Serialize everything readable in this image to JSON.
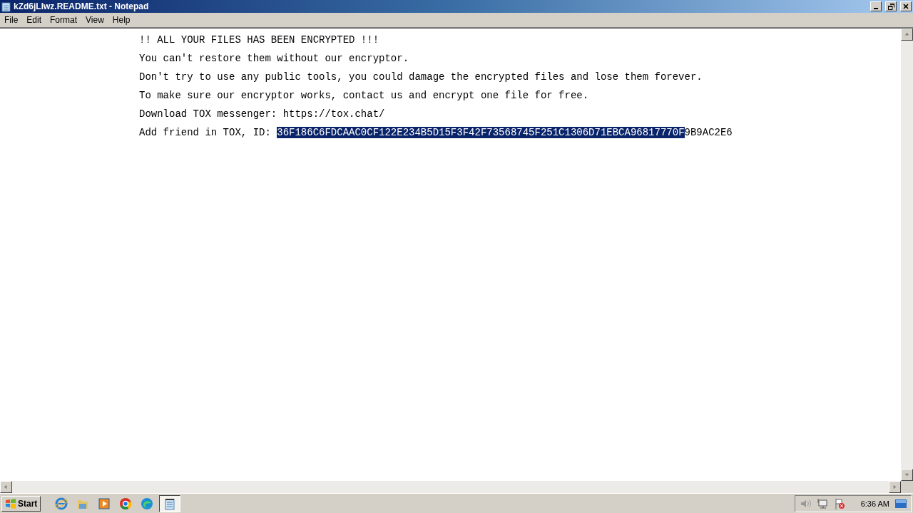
{
  "window": {
    "title": "kZd6jLIwz.README.txt - Notepad"
  },
  "menu": [
    "File",
    "Edit",
    "Format",
    "View",
    "Help"
  ],
  "document": {
    "lines": [
      {
        "segments": [
          {
            "text": "!! ALL YOUR FILES HAS BEEN ENCRYPTED !!!",
            "selected": false
          }
        ]
      },
      {
        "segments": [
          {
            "text": "You can't restore them without our encryptor.",
            "selected": false
          }
        ]
      },
      {
        "segments": [
          {
            "text": "Don't try to use any public tools, you could damage the encrypted files and lose them forever.",
            "selected": false
          }
        ]
      },
      {
        "segments": [
          {
            "text": "To make sure our encryptor works, contact us and encrypt one file for free.",
            "selected": false
          }
        ]
      },
      {
        "segments": [
          {
            "text": "Download TOX messenger: https://tox.chat/",
            "selected": false
          }
        ]
      },
      {
        "segments": [
          {
            "text": "Add friend in TOX, ID: ",
            "selected": false
          },
          {
            "text": "36F186C6FDCAAC0CF122E234B5D15F3F42F73568745F251C1306D71EBCA96817770F",
            "selected": true
          },
          {
            "text": "9B9AC2E6",
            "selected": false
          }
        ]
      }
    ]
  },
  "taskbar": {
    "start": "Start",
    "apps": [
      {
        "kind": "ie",
        "active": false
      },
      {
        "kind": "folder",
        "active": false
      },
      {
        "kind": "media",
        "active": false
      },
      {
        "kind": "chrome",
        "active": false
      },
      {
        "kind": "edge",
        "active": false
      },
      {
        "kind": "notepad",
        "active": true
      }
    ],
    "clock": "6:36 AM"
  }
}
